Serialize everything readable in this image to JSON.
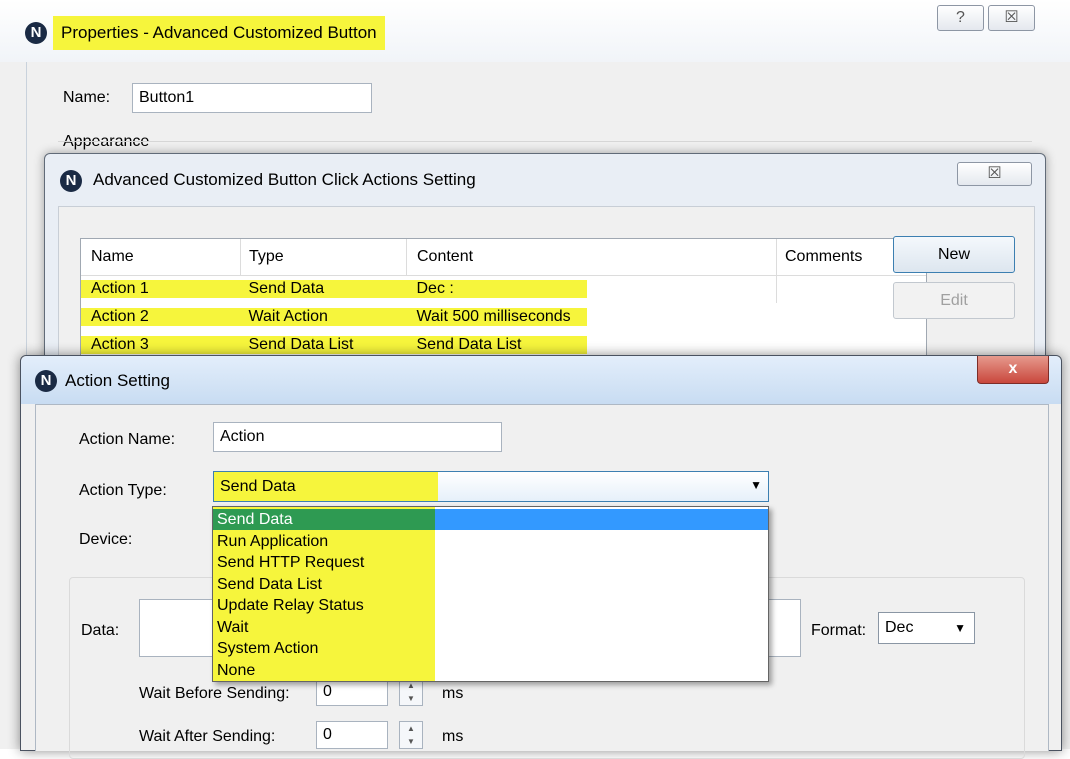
{
  "properties_window": {
    "title": "Properties - Advanced Customized Button",
    "help_glyph": "?",
    "close_glyph": "☒",
    "name_label": "Name:",
    "name_value": "Button1",
    "appearance_label": "Appearance"
  },
  "click_actions_window": {
    "title": "Advanced Customized Button Click Actions Setting",
    "close_glyph": "☒",
    "columns": [
      "Name",
      "Type",
      "Content",
      "Comments"
    ],
    "rows": [
      {
        "name": "Action 1",
        "type": "Send Data",
        "content": "Dec :",
        "comments": ""
      },
      {
        "name": "Action 2",
        "type": "Wait Action",
        "content": "Wait 500 milliseconds",
        "comments": ""
      },
      {
        "name": "Action 3",
        "type": "Send Data List",
        "content": "Send Data List",
        "comments": ""
      }
    ],
    "new_button": "New",
    "edit_button": "Edit"
  },
  "action_setting_window": {
    "title": "Action Setting",
    "close_glyph": "x",
    "action_name_label": "Action Name:",
    "action_name_value": "Action",
    "action_type_label": "Action Type:",
    "action_type_value": "Send Data",
    "device_label": "Device:",
    "data_label": "Data:",
    "format_label": "Format:",
    "format_value": "Dec",
    "wait_before_label": "Wait Before Sending:",
    "wait_before_value": "0",
    "wait_after_label": "Wait After Sending:",
    "wait_after_value": "0",
    "ms_unit": "ms",
    "dropdown_options": [
      "Send Data",
      "Run Application",
      "Send HTTP Request",
      "Send Data List",
      "Update Relay Status",
      "Wait",
      "System Action",
      "None"
    ],
    "selected_option_index": 0
  },
  "colors": {
    "highlight": "#f6f53c",
    "selection": "#3399ff",
    "close_red": "#c9473c",
    "titlebar_blue": "#c8dff5"
  },
  "icons": {
    "app_icon": "N",
    "dropdown_arrow": "▼",
    "spin_up": "▲",
    "spin_down": "▼"
  }
}
